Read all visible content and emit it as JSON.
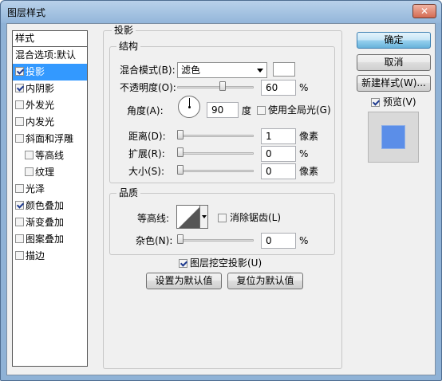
{
  "window": {
    "title": "图层样式",
    "close_glyph": "✕"
  },
  "styles_panel": {
    "header": "样式",
    "items": [
      {
        "label": "混合选项:默认",
        "checkbox": false,
        "checked": false,
        "selected": false,
        "sub": false
      },
      {
        "label": "投影",
        "checkbox": true,
        "checked": true,
        "selected": true,
        "sub": false
      },
      {
        "label": "内阴影",
        "checkbox": true,
        "checked": true,
        "selected": false,
        "sub": false
      },
      {
        "label": "外发光",
        "checkbox": true,
        "checked": false,
        "selected": false,
        "sub": false
      },
      {
        "label": "内发光",
        "checkbox": true,
        "checked": false,
        "selected": false,
        "sub": false
      },
      {
        "label": "斜面和浮雕",
        "checkbox": true,
        "checked": false,
        "selected": false,
        "sub": false
      },
      {
        "label": "等高线",
        "checkbox": true,
        "checked": false,
        "selected": false,
        "sub": true
      },
      {
        "label": "纹理",
        "checkbox": true,
        "checked": false,
        "selected": false,
        "sub": true
      },
      {
        "label": "光泽",
        "checkbox": true,
        "checked": false,
        "selected": false,
        "sub": false
      },
      {
        "label": "颜色叠加",
        "checkbox": true,
        "checked": true,
        "selected": false,
        "sub": false
      },
      {
        "label": "渐变叠加",
        "checkbox": true,
        "checked": false,
        "selected": false,
        "sub": false
      },
      {
        "label": "图案叠加",
        "checkbox": true,
        "checked": false,
        "selected": false,
        "sub": false
      },
      {
        "label": "描边",
        "checkbox": true,
        "checked": false,
        "selected": false,
        "sub": false
      }
    ]
  },
  "drop_shadow": {
    "title": "投影",
    "structure": {
      "title": "结构",
      "blend_mode_label": "混合模式(B):",
      "blend_mode_value": "滤色",
      "blend_color": "#ffffff",
      "opacity_label": "不透明度(O):",
      "opacity_value": "60",
      "opacity_unit": "%",
      "opacity_fraction": 0.6,
      "angle_label": "角度(A):",
      "angle_value": "90",
      "angle_unit": "度",
      "global_light_label": "使用全局光(G)",
      "global_light_checked": false,
      "distance_label": "距离(D):",
      "distance_value": "1",
      "distance_unit": "像素",
      "spread_label": "扩展(R):",
      "spread_value": "0",
      "spread_unit": "%",
      "size_label": "大小(S):",
      "size_value": "0",
      "size_unit": "像素"
    },
    "quality": {
      "title": "品质",
      "contour_label": "等高线:",
      "antialias_label": "消除锯齿(L)",
      "antialias_checked": false,
      "noise_label": "杂色(N):",
      "noise_value": "0",
      "noise_unit": "%"
    },
    "knockout_label": "图层挖空投影(U)",
    "knockout_checked": true,
    "make_default_label": "设置为默认值",
    "reset_default_label": "复位为默认值"
  },
  "actions": {
    "ok_label": "确定",
    "cancel_label": "取消",
    "new_style_label": "新建样式(W)...",
    "preview_label": "预览(V)",
    "preview_checked": true,
    "preview_color": "#5b8ee8"
  }
}
